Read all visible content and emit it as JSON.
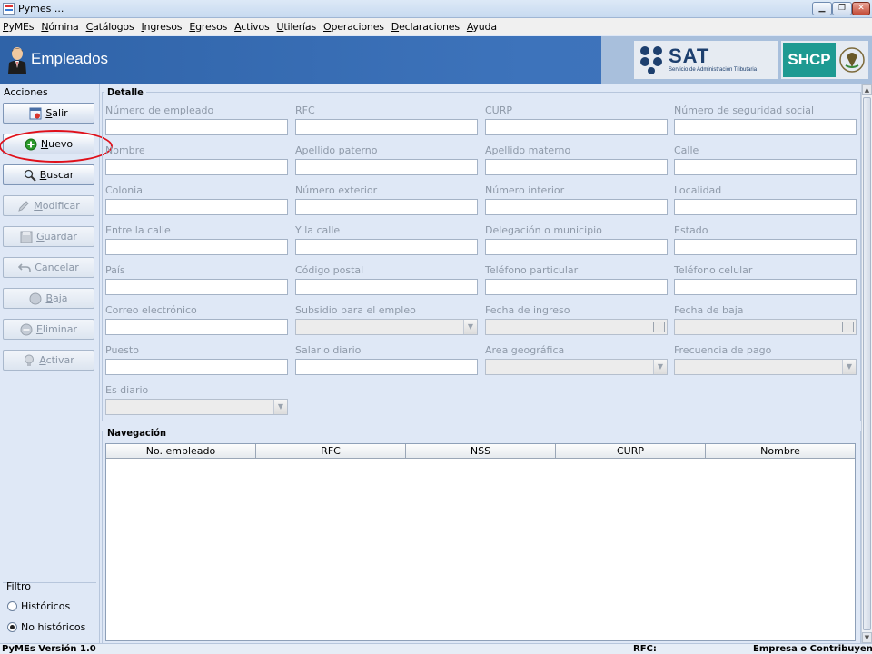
{
  "window": {
    "title": "Pymes ...",
    "min": "▁",
    "max": "❐",
    "close": "✕"
  },
  "menu": [
    "PyMEs",
    "Nómina",
    "Catálogos",
    "Ingresos",
    "Egresos",
    "Activos",
    "Utilerías",
    "Operaciones",
    "Declaraciones",
    "Ayuda"
  ],
  "header": {
    "title": "Empleados",
    "sat_logo": "SAT",
    "sat_subtitle": "Servicio de Administración Tributaria",
    "shcp_logo": "SHCP"
  },
  "actions": {
    "label": "Acciones",
    "buttons": [
      {
        "label": "Salir",
        "icon": "exit-icon",
        "enabled": true
      },
      {
        "label": "Nuevo",
        "icon": "add-icon",
        "enabled": true
      },
      {
        "label": "Buscar",
        "icon": "search-icon",
        "enabled": true
      },
      {
        "label": "Modificar",
        "icon": "pencil-icon",
        "enabled": false
      },
      {
        "label": "Guardar",
        "icon": "save-icon",
        "enabled": false
      },
      {
        "label": "Cancelar",
        "icon": "undo-icon",
        "enabled": false
      },
      {
        "label": "Baja",
        "icon": "circle-icon",
        "enabled": false
      },
      {
        "label": "Eliminar",
        "icon": "delete-icon",
        "enabled": false
      },
      {
        "label": "Activar",
        "icon": "bulb-icon",
        "enabled": false
      }
    ]
  },
  "filter": {
    "label": "Filtro",
    "options": [
      {
        "label": "Históricos",
        "selected": false
      },
      {
        "label": "No históricos",
        "selected": true
      }
    ]
  },
  "detail": {
    "legend": "Detalle",
    "fields": [
      {
        "label": "Número de empleado",
        "type": "text",
        "value": ""
      },
      {
        "label": "RFC",
        "type": "text",
        "value": ""
      },
      {
        "label": "CURP",
        "type": "text",
        "value": ""
      },
      {
        "label": "Número de seguridad social",
        "type": "text",
        "value": ""
      },
      {
        "label": "Nombre",
        "type": "text",
        "value": ""
      },
      {
        "label": "Apellido paterno",
        "type": "text",
        "value": ""
      },
      {
        "label": "Apellido materno",
        "type": "text",
        "value": ""
      },
      {
        "label": "Calle",
        "type": "text",
        "value": ""
      },
      {
        "label": "Colonia",
        "type": "text",
        "value": ""
      },
      {
        "label": "Número exterior",
        "type": "text",
        "value": ""
      },
      {
        "label": "Número interior",
        "type": "text",
        "value": ""
      },
      {
        "label": "Localidad",
        "type": "text",
        "value": ""
      },
      {
        "label": "Entre la calle",
        "type": "text",
        "value": ""
      },
      {
        "label": "Y la calle",
        "type": "text",
        "value": ""
      },
      {
        "label": "Delegación o municipio",
        "type": "text",
        "value": ""
      },
      {
        "label": "Estado",
        "type": "text",
        "value": ""
      },
      {
        "label": "País",
        "type": "text",
        "value": ""
      },
      {
        "label": "Código postal",
        "type": "text",
        "value": ""
      },
      {
        "label": "Teléfono particular",
        "type": "text",
        "value": ""
      },
      {
        "label": "Teléfono celular",
        "type": "text",
        "value": ""
      },
      {
        "label": "Correo electrónico",
        "type": "text",
        "value": ""
      },
      {
        "label": "Subsidio para el empleo",
        "type": "combo",
        "value": ""
      },
      {
        "label": "Fecha de ingreso",
        "type": "date",
        "value": ""
      },
      {
        "label": "Fecha de baja",
        "type": "date",
        "value": ""
      },
      {
        "label": "Puesto",
        "type": "text",
        "value": ""
      },
      {
        "label": "Salario diario",
        "type": "text",
        "value": ""
      },
      {
        "label": "Area geográfica",
        "type": "combo",
        "value": ""
      },
      {
        "label": "Frecuencia de pago",
        "type": "combo",
        "value": ""
      },
      {
        "label": "Es diario",
        "type": "combo",
        "value": ""
      }
    ]
  },
  "navigation": {
    "legend": "Navegación",
    "columns": [
      "No. empleado",
      "RFC",
      "NSS",
      "CURP",
      "Nombre"
    ],
    "rows": []
  },
  "status": {
    "version": "PyMEs Versión 1.0",
    "rfc_label": "RFC:",
    "company_label": "Empresa o Contribuyente:"
  }
}
